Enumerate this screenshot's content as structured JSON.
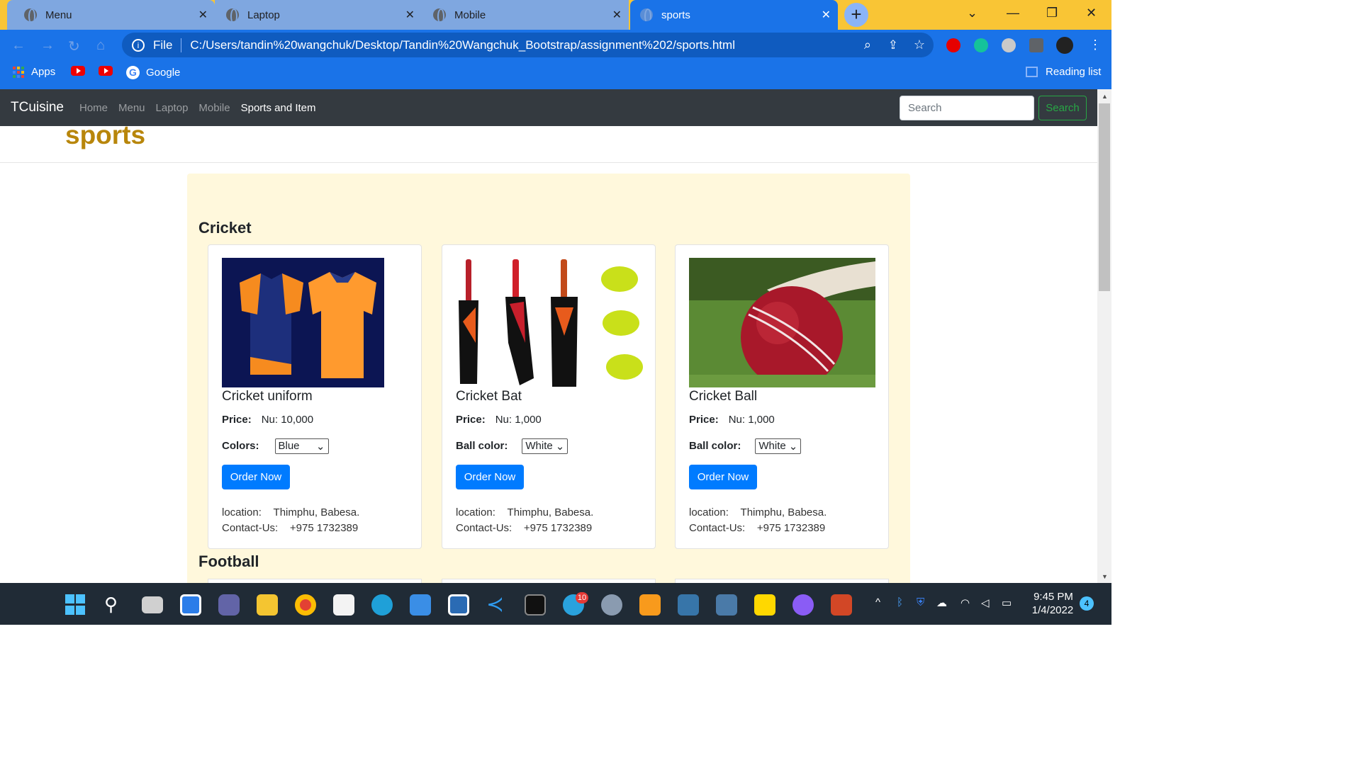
{
  "browser": {
    "tabs": [
      {
        "label": "Menu"
      },
      {
        "label": "Laptop"
      },
      {
        "label": "Mobile"
      },
      {
        "label": "sports"
      }
    ],
    "url_scheme": "File",
    "url": "C:/Users/tandin%20wangchuk/Desktop/Tandin%20Wangchuk_Bootstrap/assignment%202/sports.html",
    "bookmarks": {
      "apps": "Apps",
      "google": "Google",
      "reading_list": "Reading list"
    }
  },
  "navbar": {
    "brand": "TCuisine",
    "links": [
      "Home",
      "Menu",
      "Laptop",
      "Mobile",
      "Sports and Item"
    ],
    "search_placeholder": "Search",
    "search_button": "Search"
  },
  "page": {
    "title": "sports",
    "sections": [
      {
        "name": "Cricket",
        "products": [
          {
            "title": "Cricket uniform",
            "price_label": "Price:",
            "price": "Nu: 10,000",
            "option_label": "Colors:",
            "option_value": "Blue",
            "button": "Order Now",
            "location_label": "location:",
            "location": "Thimphu, Babesa.",
            "contact_label": "Contact-Us:",
            "contact": "+975 1732389"
          },
          {
            "title": "Cricket Bat",
            "price_label": "Price:",
            "price": "Nu: 1,000",
            "option_label": "Ball color:",
            "option_value": "White",
            "button": "Order Now",
            "location_label": "location:",
            "location": "Thimphu, Babesa.",
            "contact_label": "Contact-Us:",
            "contact": "+975 1732389"
          },
          {
            "title": "Cricket Ball",
            "price_label": "Price:",
            "price": "Nu: 1,000",
            "option_label": "Ball color:",
            "option_value": "White",
            "button": "Order Now",
            "location_label": "location:",
            "location": "Thimphu, Babesa.",
            "contact_label": "Contact-Us:",
            "contact": "+975 1732389"
          }
        ]
      },
      {
        "name": "Football"
      }
    ]
  },
  "taskbar": {
    "time": "9:45 PM",
    "date": "1/4/2022",
    "notifications": "4",
    "telegram_badge": "10"
  },
  "colors": {
    "accent": "#1a73e8",
    "title": "#b8860b",
    "primary_button": "#007bff",
    "navbar": "#343a40",
    "jumbotron": "#fff8dc",
    "success": "#28a745"
  }
}
